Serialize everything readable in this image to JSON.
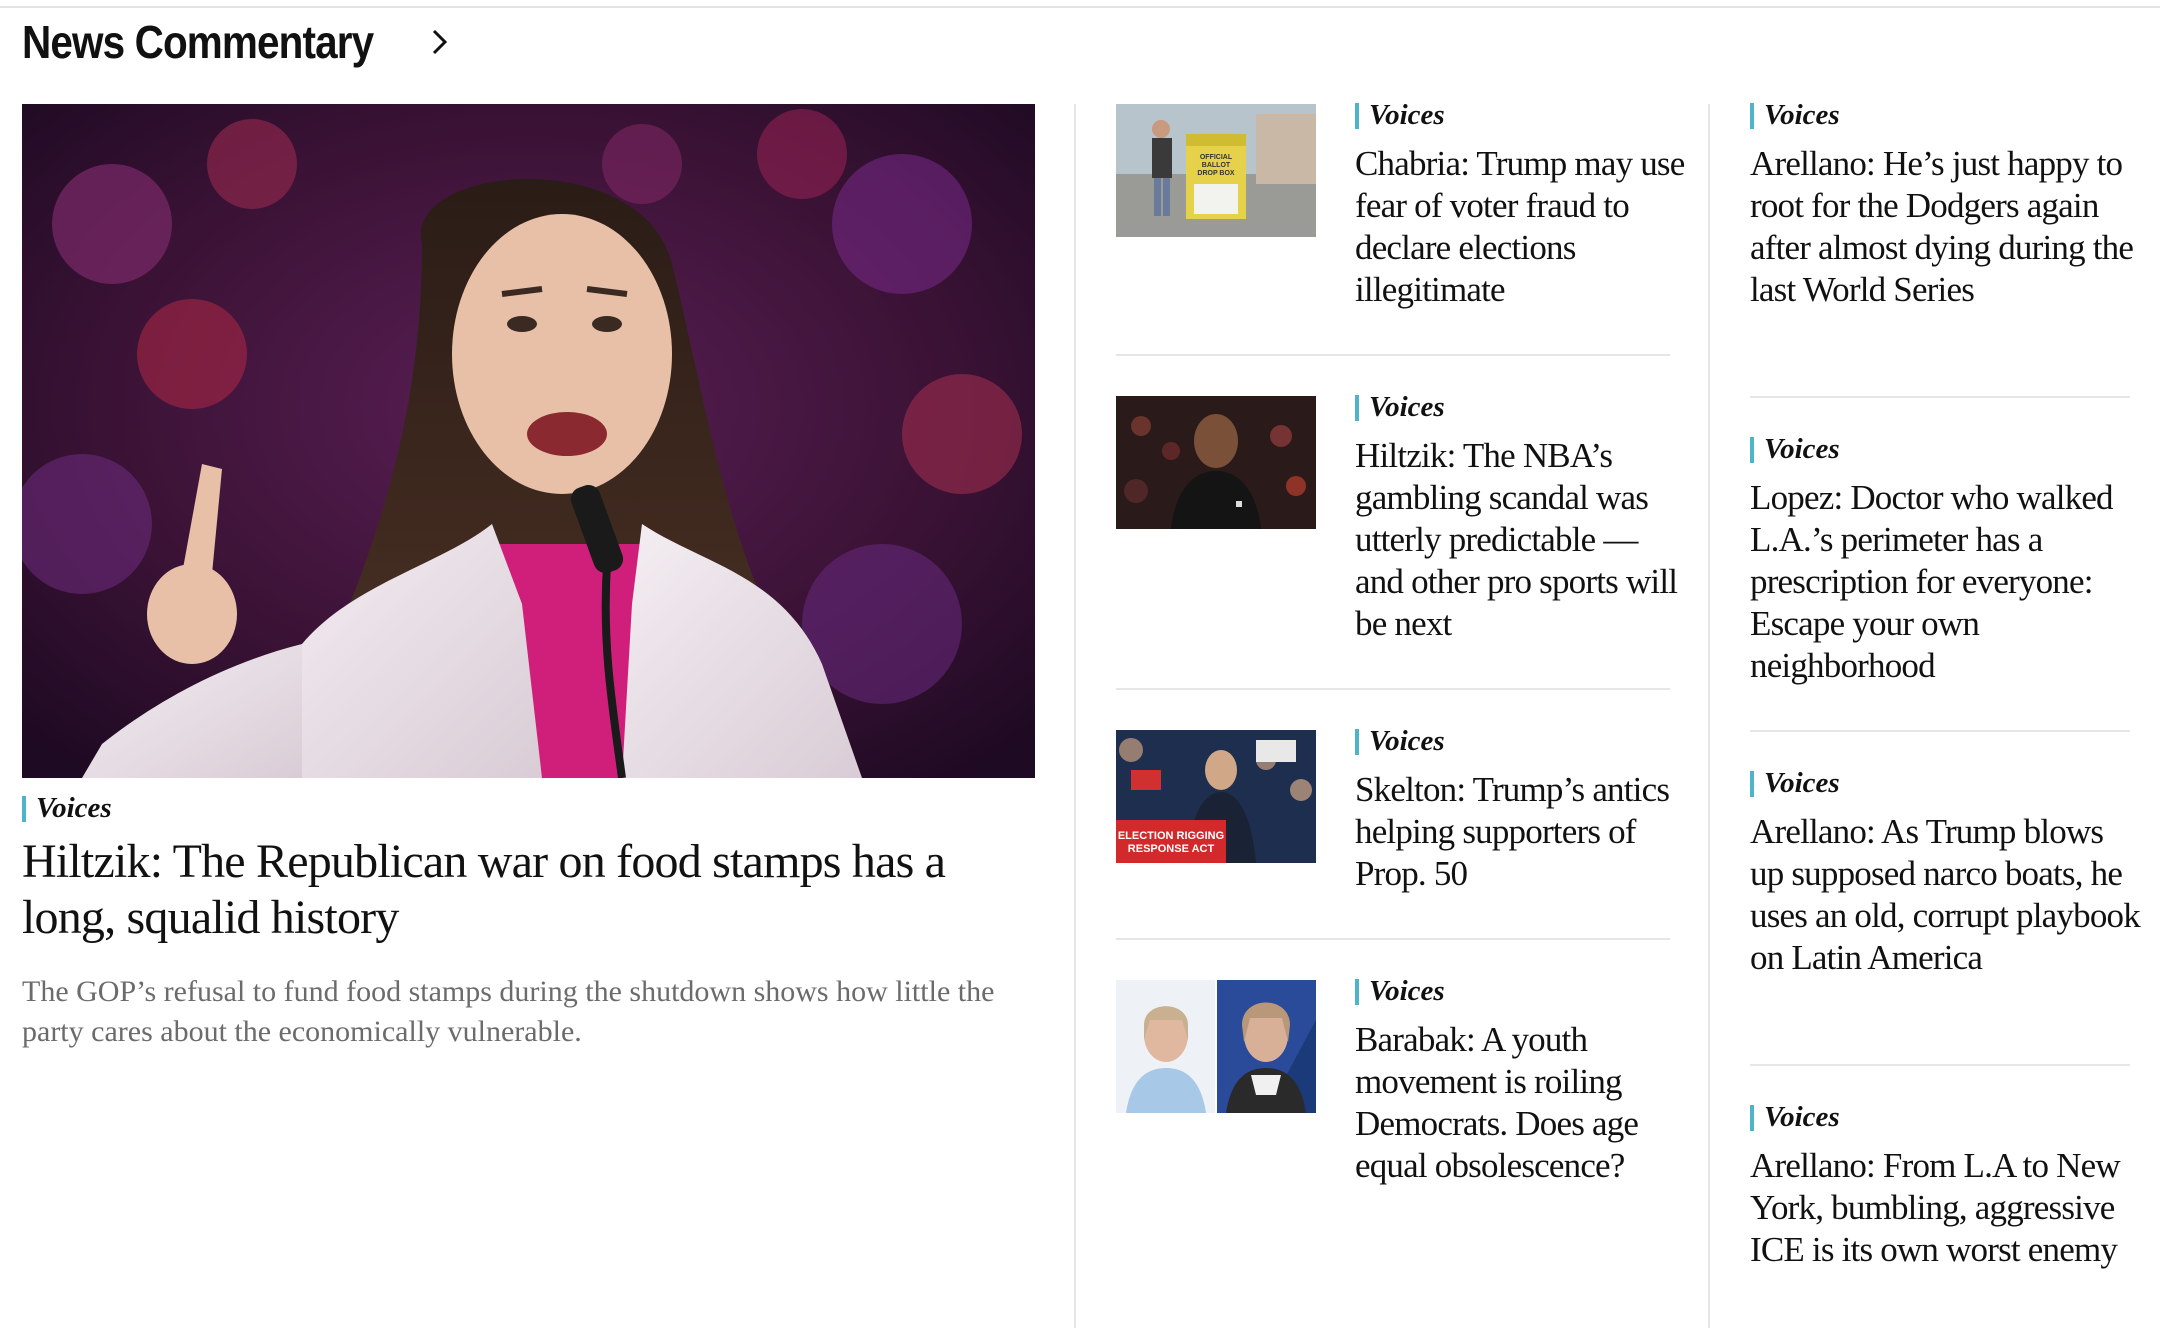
{
  "section": {
    "title": "News Commentary",
    "chevron_icon": "chevron-right-icon"
  },
  "hero": {
    "kicker": "Voices",
    "title": "Hiltzik: The Republican war on food stamps has a long, squalid history",
    "description": "The GOP’s refusal to fund food stamps during the shutdown shows how little the party cares about the economically vulnerable."
  },
  "middle_column": [
    {
      "kicker": "Voices",
      "title": "Chabria: Trump may use fear of voter fraud to declare elections illegitimate",
      "thumb_text": [
        "OFFICIAL",
        "BALLOT",
        "DROP BOX"
      ]
    },
    {
      "kicker": "Voices",
      "title": "Hiltzik: The NBA’s gambling scandal was utterly predictable — and other pro sports will be next"
    },
    {
      "kicker": "Voices",
      "title": "Skelton: Trump’s antics helping supporters of Prop. 50",
      "thumb_text": [
        "ELECTION RIGGING",
        "RESPONSE ACT"
      ]
    },
    {
      "kicker": "Voices",
      "title": "Barabak: A youth movement is roiling Democrats. Does age equal obsolescence?"
    }
  ],
  "right_column": [
    {
      "kicker": "Voices",
      "title": "Arellano: He’s just happy to root for the Dodgers again after almost dying during the last World Series"
    },
    {
      "kicker": "Voices",
      "title": "Lopez: Doctor who walked L.A.’s perimeter has a prescription for everyone: Escape your own neighborhood"
    },
    {
      "kicker": "Voices",
      "title": "Arellano: As Trump blows up supposed narco boats, he uses an old, corrupt playbook on Latin America"
    },
    {
      "kicker": "Voices",
      "title": "Arellano: From L.A to New York, bumbling, aggressive ICE is its own worst enemy"
    }
  ],
  "colors": {
    "kicker_accent": "#4fb3c9",
    "divider": "#e6e6e6",
    "description": "#6b6b6b"
  }
}
